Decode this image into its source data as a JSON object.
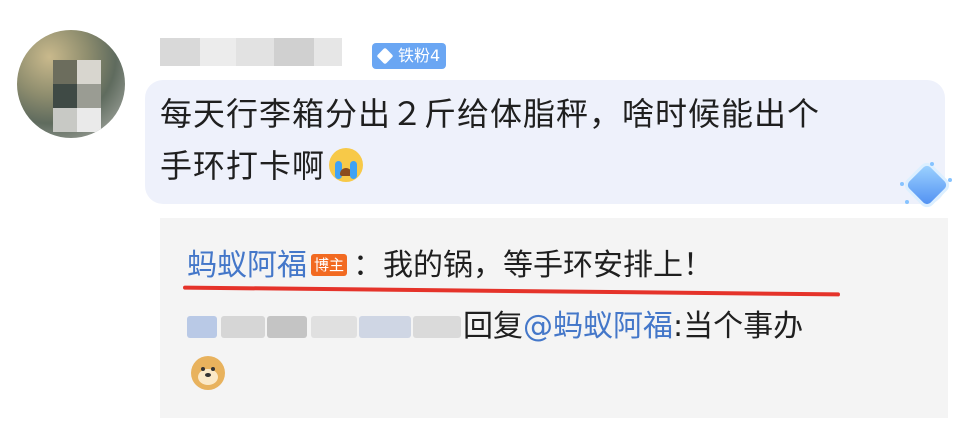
{
  "comment": {
    "badge_label": "铁粉4",
    "username_suffix": "_",
    "text_line1": "每天行李箱分出２斤给体脂秤，啥时候能出个",
    "text_line2": "手环打卡啊",
    "emoji": "cry-emoji"
  },
  "replies": [
    {
      "author": "蚂蚁阿福",
      "author_badge": "博主",
      "separator": "：",
      "text": "我的锅，等手环安排上！"
    },
    {
      "reply_word": "回复",
      "mention": "@蚂蚁阿福",
      "separator": ":",
      "text": "当个事办",
      "emoji": "doge-emoji"
    }
  ],
  "colors": {
    "link_blue": "#4477c9",
    "badge_blue": "#6aa6f3",
    "blogger_orange": "#f26a21",
    "highlight_red": "#e5332a",
    "bubble_bg": "#eef1fb",
    "reply_bg": "#f4f4f4"
  }
}
